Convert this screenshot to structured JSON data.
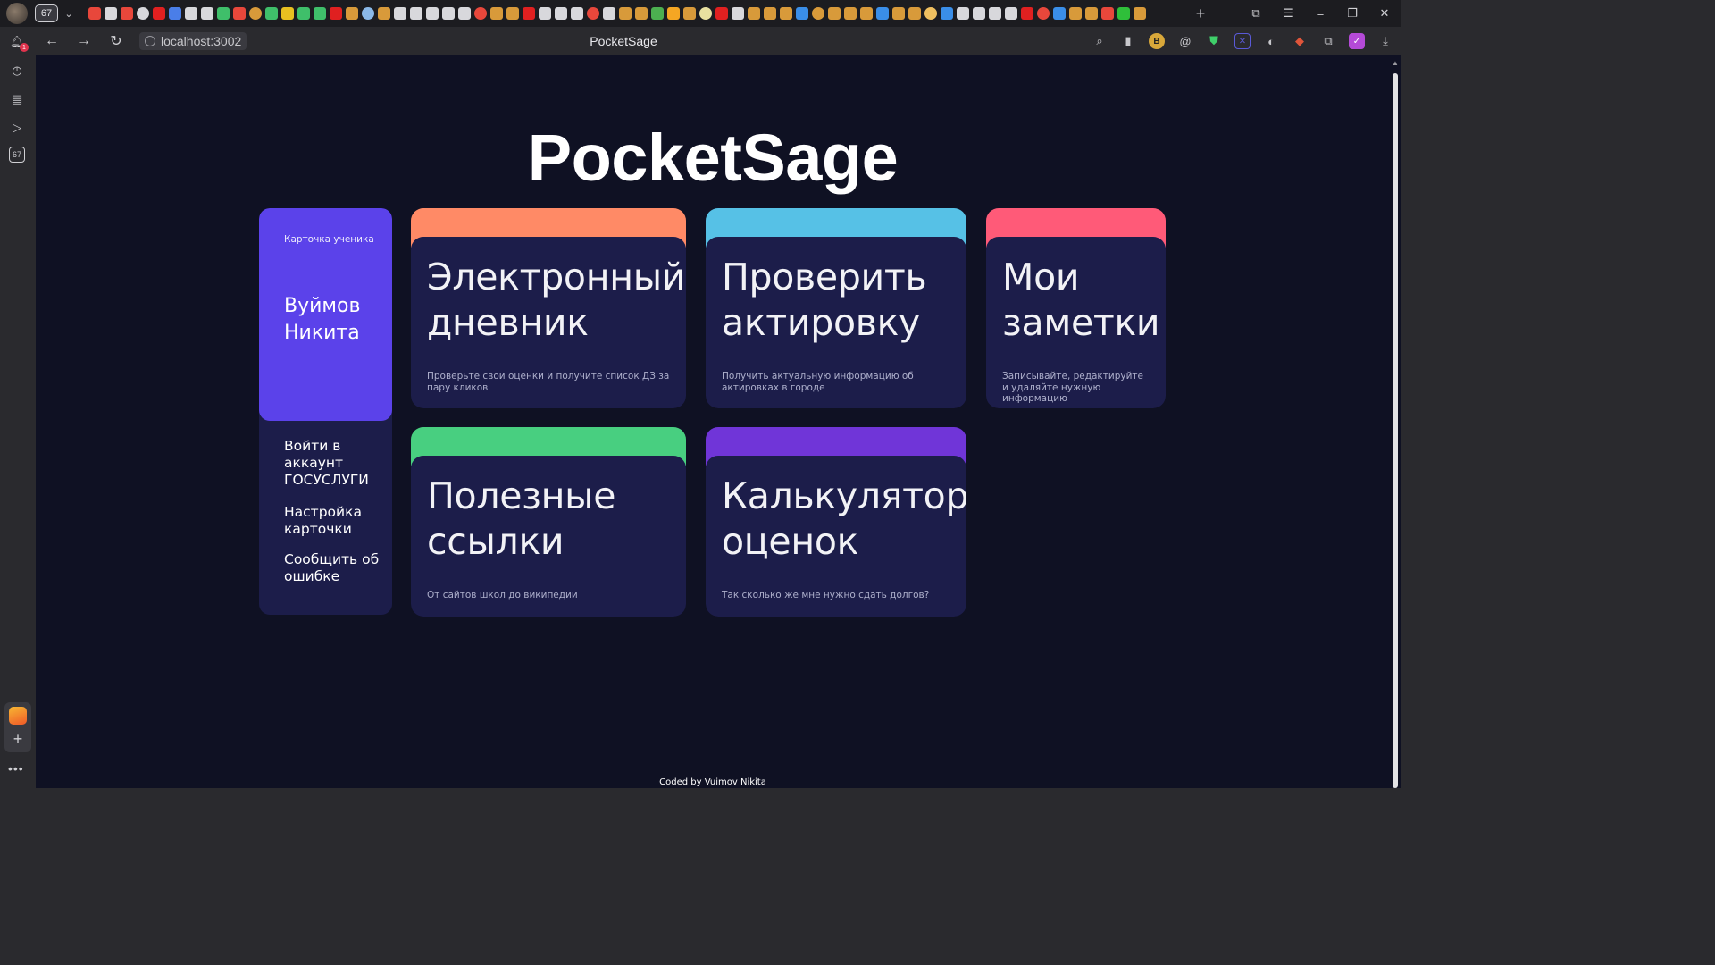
{
  "browser": {
    "tab_count": "67",
    "url": "localhost:3002",
    "page_title": "PocketSage",
    "notification_badge": "1",
    "sidebar_counter": "67",
    "colors": {
      "tabstrip": "#1c1c20",
      "toolbar": "#2a2a2e"
    }
  },
  "page": {
    "title": "PocketSage",
    "footer": "Coded by Vuimov Nikita"
  },
  "student_card": {
    "label": "Карточка ученика",
    "name": "Вуймов Никита",
    "links": [
      {
        "label": "Войти в аккаунт ГОСУСЛУГИ"
      },
      {
        "label": "Настройка карточки"
      },
      {
        "label": "Сообщить об ошибке"
      }
    ],
    "accent": "#5b42ea"
  },
  "cards": [
    {
      "title": "Электронный дневник",
      "description": "Проверьте свои оценки и получите список ДЗ за пару кликов",
      "accent": "#ff8a66"
    },
    {
      "title": "Проверить актировку",
      "description": "Получить актуальную информацию об актировках в городе",
      "accent": "#56c1e6"
    },
    {
      "title": "Мои заметки",
      "description": "Записывайте, редактируйте и удаляйте нужную информацию",
      "accent": "#ff5a78"
    },
    {
      "title": "Полезные ссылки",
      "description": "От сайтов школ до википедии",
      "accent": "#48cf80"
    },
    {
      "title": "Калькулятор оценок",
      "description": "Так сколько же мне нужно сдать долгов?",
      "accent": "#7035d8"
    }
  ]
}
